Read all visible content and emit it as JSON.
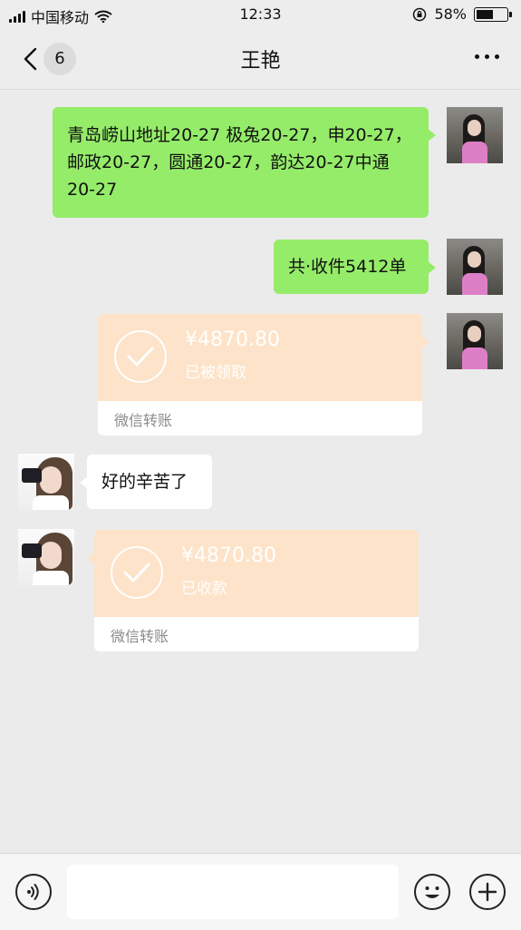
{
  "status_bar": {
    "carrier": "中国移动",
    "time": "12:33",
    "battery": "58%",
    "battery_level": 0.58
  },
  "header": {
    "back_count": "6",
    "title": "王艳"
  },
  "messages": [
    {
      "from": "self",
      "type": "text",
      "text": "青岛崂山地址20-27 极兔20-27，申20-27，邮政20-27，圆通20-27，韵达20-27中通20-27"
    },
    {
      "from": "self",
      "type": "text",
      "text": "共·收件5412单"
    },
    {
      "from": "self",
      "type": "transfer",
      "amount": "¥4870.80",
      "status": "已被领取",
      "label": "微信转账"
    },
    {
      "from": "other",
      "type": "text",
      "text": "好的辛苦了"
    },
    {
      "from": "other",
      "type": "transfer",
      "amount": "¥4870.80",
      "status": "已收款",
      "label": "微信转账"
    }
  ],
  "input": {
    "value": ""
  },
  "icons": {
    "back": "chevron-left-icon",
    "more": "more-icon",
    "voice": "voice-icon",
    "emoji": "emoji-icon",
    "plus": "plus-icon",
    "check": "check-icon"
  }
}
